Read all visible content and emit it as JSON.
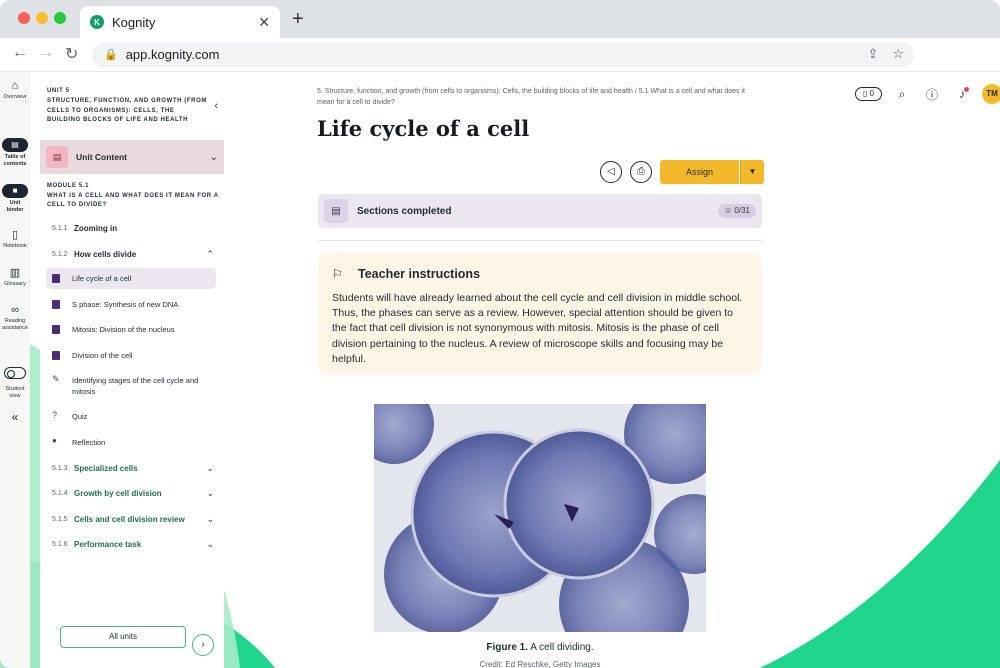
{
  "browser": {
    "tab_title": "Kognity",
    "favicon_text": "K",
    "url": "app.kognity.com"
  },
  "rail": {
    "overview": "Overview",
    "toc_line1": "Table of",
    "toc_line2": "contents",
    "unit_binder_line1": "Unit",
    "unit_binder_line2": "binder",
    "notebook": "Notebook",
    "glossary": "Glossary",
    "reading_line1": "Reading",
    "reading_line2": "assistance",
    "student_line1": "Student",
    "student_line2": "view"
  },
  "sidebar": {
    "unit_label": "UNIT 5",
    "unit_title": "STRUCTURE, FUNCTION, AND GROWTH (FROM CELLS TO ORGANISMS): CELLS, THE BUILDING BLOCKS OF LIFE AND HEALTH",
    "unit_content_label": "Unit Content",
    "module_label": "MODULE 5.1",
    "module_title": "WHAT IS A CELL AND WHAT DOES IT MEAN FOR A CELL TO DIVIDE?",
    "sections": [
      {
        "num": "5.1.1",
        "title": "Zooming in"
      },
      {
        "num": "5.1.2",
        "title": "How cells divide"
      },
      {
        "num": "5.1.3",
        "title": "Specialized cells"
      },
      {
        "num": "5.1.4",
        "title": "Growth by cell division"
      },
      {
        "num": "5.1.5",
        "title": "Cells and cell division review"
      },
      {
        "num": "5.1.6",
        "title": "Performance task"
      }
    ],
    "subsections": [
      "Life cycle of a cell",
      "S phase: Synthesis of new DNA",
      "Mitosis: Division of the nucleus",
      "Division of the cell",
      "Identifying stages of the cell cycle and mitosis",
      "Quiz",
      "Reflection"
    ],
    "all_units": "All units"
  },
  "main": {
    "breadcrumb": "5. Structure, function, and growth (from cells to organisms): Cells, the building blocks of life and health / 5.1 What is a cell and what does it mean for a cell to divide?",
    "title": "Life cycle of a cell",
    "assign_label": "Assign",
    "sections_completed_label": "Sections completed",
    "sections_count": "0/31",
    "teacher_title": "Teacher instructions",
    "teacher_body": "Students will have already learned about the cell cycle and cell division in middle school. Thus, the phases can serve as a review. However, special attention should be given to the fact that cell division is not synonymous with mitosis. Mitosis is the phase of cell division pertaining to the nucleus. A review of microscope skills and focusing may be helpful.",
    "figure_label": "Figure 1.",
    "figure_caption": "A cell dividing.",
    "figure_credit": "Credit: Ed Reschke, Getty Images"
  },
  "topbar": {
    "notes_count": "0",
    "avatar_initials": "TM"
  },
  "colors": {
    "brand_green": "#1fd58c",
    "assign_yellow": "#f4b92a",
    "active_item_bg": "#ece6f1",
    "teacher_bg": "#fdf6e6"
  },
  "icons": {
    "home": "home-icon",
    "toc": "book-icon",
    "binder": "folder-icon",
    "notebook": "notebook-icon",
    "glossary": "glossary-icon",
    "reading": "glasses-icon",
    "student": "eye-toggle-icon",
    "collapse": "double-chevron-left-icon"
  }
}
